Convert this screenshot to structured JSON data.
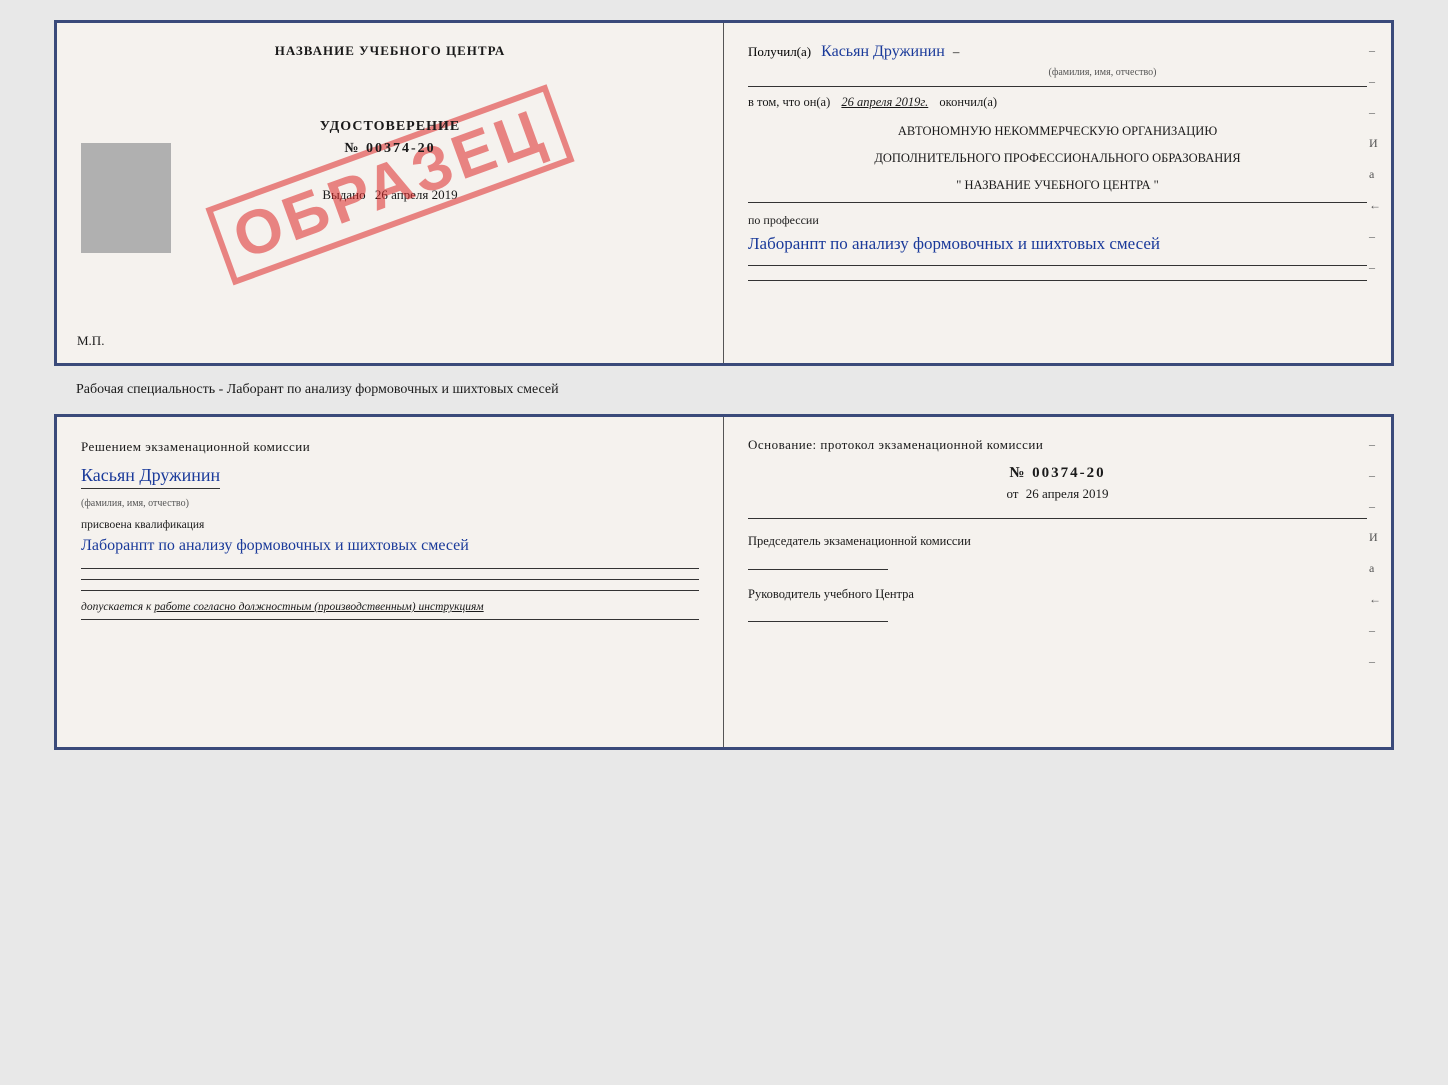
{
  "top_doc": {
    "left": {
      "title": "НАЗВАНИЕ УЧЕБНОГО ЦЕНТРА",
      "cert_label": "УДОСТОВЕРЕНИЕ",
      "cert_number": "№ 00374-20",
      "issued_label": "Выдано",
      "issued_date": "26 апреля 2019",
      "mp_label": "М.П.",
      "stamp_text": "ОБРАЗЕЦ"
    },
    "right": {
      "received_prefix": "Получил(а)",
      "received_name": "Касьян Дружинин",
      "received_name_subtitle": "(фамилия, имя, отчество)",
      "in_that_prefix": "в том, что он(а)",
      "in_that_date": "26 апреля 2019г.",
      "in_that_suffix": "окончил(а)",
      "org_line1": "АВТОНОМНУЮ НЕКОММЕРЧЕСКУЮ ОРГАНИЗАЦИЮ",
      "org_line2": "ДОПОЛНИТЕЛЬНОГО ПРОФЕССИОНАЛЬНОГО ОБРАЗОВАНИЯ",
      "org_line3": "\"  НАЗВАНИЕ УЧЕБНОГО ЦЕНТРА  \"",
      "profession_label": "по профессии",
      "profession_text": "Лаборанпт по анализу формовочных и шихтовых смесей"
    }
  },
  "middle_label": "Рабочая специальность - Лаборант по анализу формовочных и шихтовых смесей",
  "bottom_doc": {
    "left": {
      "resolution_text": "Решением  экзаменационной  комиссии",
      "name": "Касьян Дружинин",
      "name_subtitle": "(фамилия, имя, отчество)",
      "qualification_label": "присвоена квалификация",
      "qualification_text": "Лаборанпт по анализу формовочных и шихтовых смесей",
      "admit_label": "допускается к",
      "admit_text": "работе согласно должностным (производственным) инструкциям"
    },
    "right": {
      "basis_text": "Основание:  протокол  экзаменационной  комиссии",
      "protocol_number": "№  00374-20",
      "from_label": "от",
      "from_date": "26 апреля 2019",
      "chairman_label": "Председатель экзаменационной комиссии",
      "director_label": "Руководитель учебного Центра"
    }
  },
  "side_chars": {
    "line1": "–",
    "line2": "–",
    "line3": "–",
    "line4": "И",
    "line5": "а",
    "line6": "←",
    "line7": "–",
    "line8": "–"
  }
}
